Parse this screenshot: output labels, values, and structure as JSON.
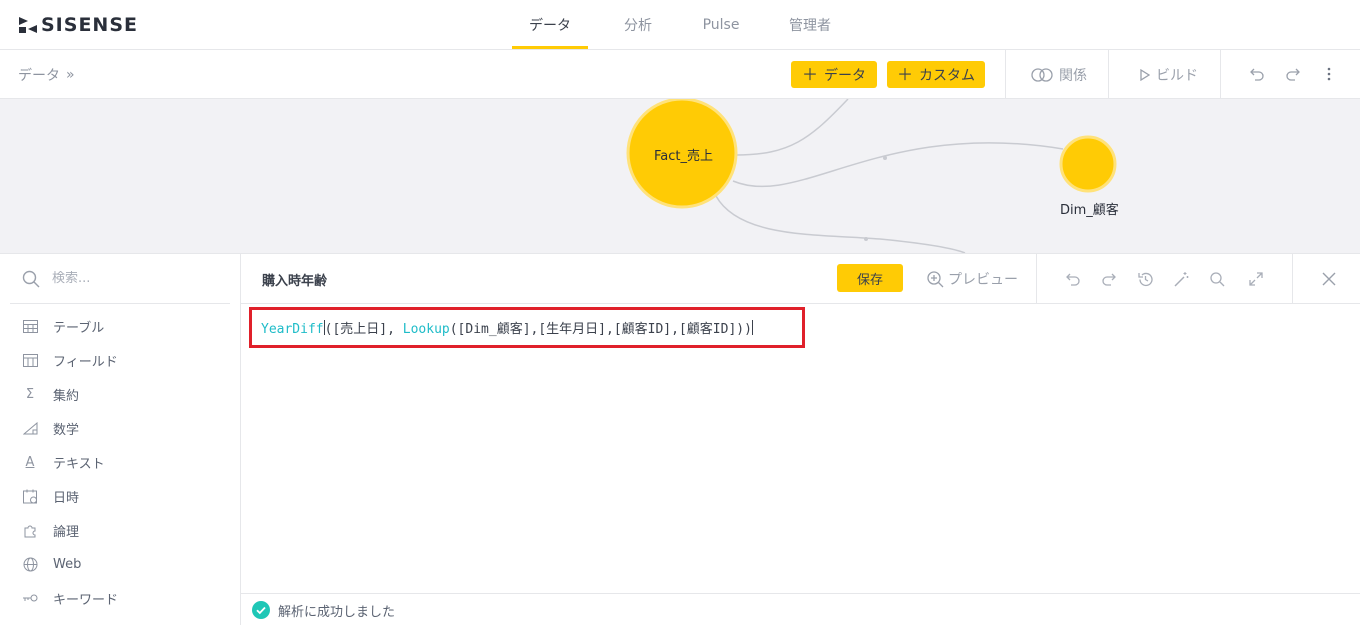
{
  "app": {
    "logo_text": "SISENSE"
  },
  "nav": {
    "tabs": [
      {
        "label": "データ",
        "active": true
      },
      {
        "label": "分析",
        "active": false
      },
      {
        "label": "Pulse",
        "active": false
      },
      {
        "label": "管理者",
        "active": false
      }
    ]
  },
  "toolbar": {
    "breadcrumb": "データ",
    "breadcrumb_chevron": "»",
    "add_data_label": "データ",
    "add_custom_label": "カスタム",
    "relations_label": "関係",
    "build_label": "ビルド",
    "plus": "＋"
  },
  "canvas": {
    "nodes": [
      {
        "label": "Fact_売上"
      },
      {
        "label": "Dim_顧客"
      }
    ]
  },
  "sidebar": {
    "search_placeholder": "検索...",
    "categories": [
      {
        "label": "テーブル",
        "icon": "table-icon"
      },
      {
        "label": "フィールド",
        "icon": "field-icon"
      },
      {
        "label": "集約",
        "icon": "sigma-icon"
      },
      {
        "label": "数学",
        "icon": "math-icon"
      },
      {
        "label": "テキスト",
        "icon": "text-icon"
      },
      {
        "label": "日時",
        "icon": "calendar-icon"
      },
      {
        "label": "論理",
        "icon": "puzzle-icon"
      },
      {
        "label": "Web",
        "icon": "globe-icon"
      },
      {
        "label": "キーワード",
        "icon": "key-icon"
      }
    ],
    "sigma_glyph": "Σ",
    "text_glyph": "A"
  },
  "editor": {
    "title": "購入時年齢",
    "save_label": "保存",
    "preview_label": "プレビュー",
    "formula": {
      "fn1": "YearDiff",
      "part1": "([売上日], ",
      "fn2": "Lookup",
      "part2": "([Dim_顧客],[生年月日],[顧客ID],[顧客ID]))"
    },
    "status": "解析に成功しました"
  },
  "colors": {
    "accent": "#ffcb05",
    "highlight_border": "#e0202a",
    "function_text": "#1fbcc8",
    "success": "#1fc7b6"
  }
}
